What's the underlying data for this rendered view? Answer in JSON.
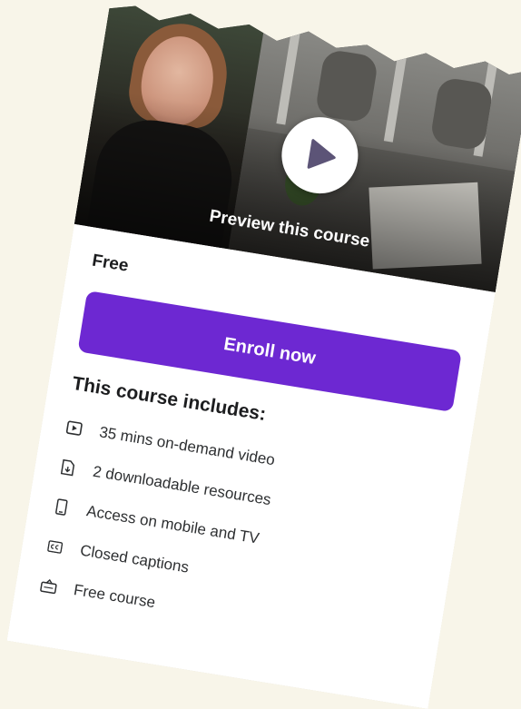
{
  "preview": {
    "label": "Preview this course"
  },
  "price": "Free",
  "enroll_label": "Enroll now",
  "includes": {
    "title": "This course includes:",
    "items": [
      {
        "icon": "video-icon",
        "label": "35 mins on-demand video"
      },
      {
        "icon": "download-file-icon",
        "label": "2 downloadable resources"
      },
      {
        "icon": "mobile-icon",
        "label": "Access on mobile and TV"
      },
      {
        "icon": "closed-captions-icon",
        "label": "Closed captions"
      },
      {
        "icon": "certificate-icon",
        "label": "Free course"
      }
    ]
  },
  "colors": {
    "background": "#f8f5e9",
    "enroll_button": "#6d28d2",
    "text": "#1c1d1f"
  }
}
